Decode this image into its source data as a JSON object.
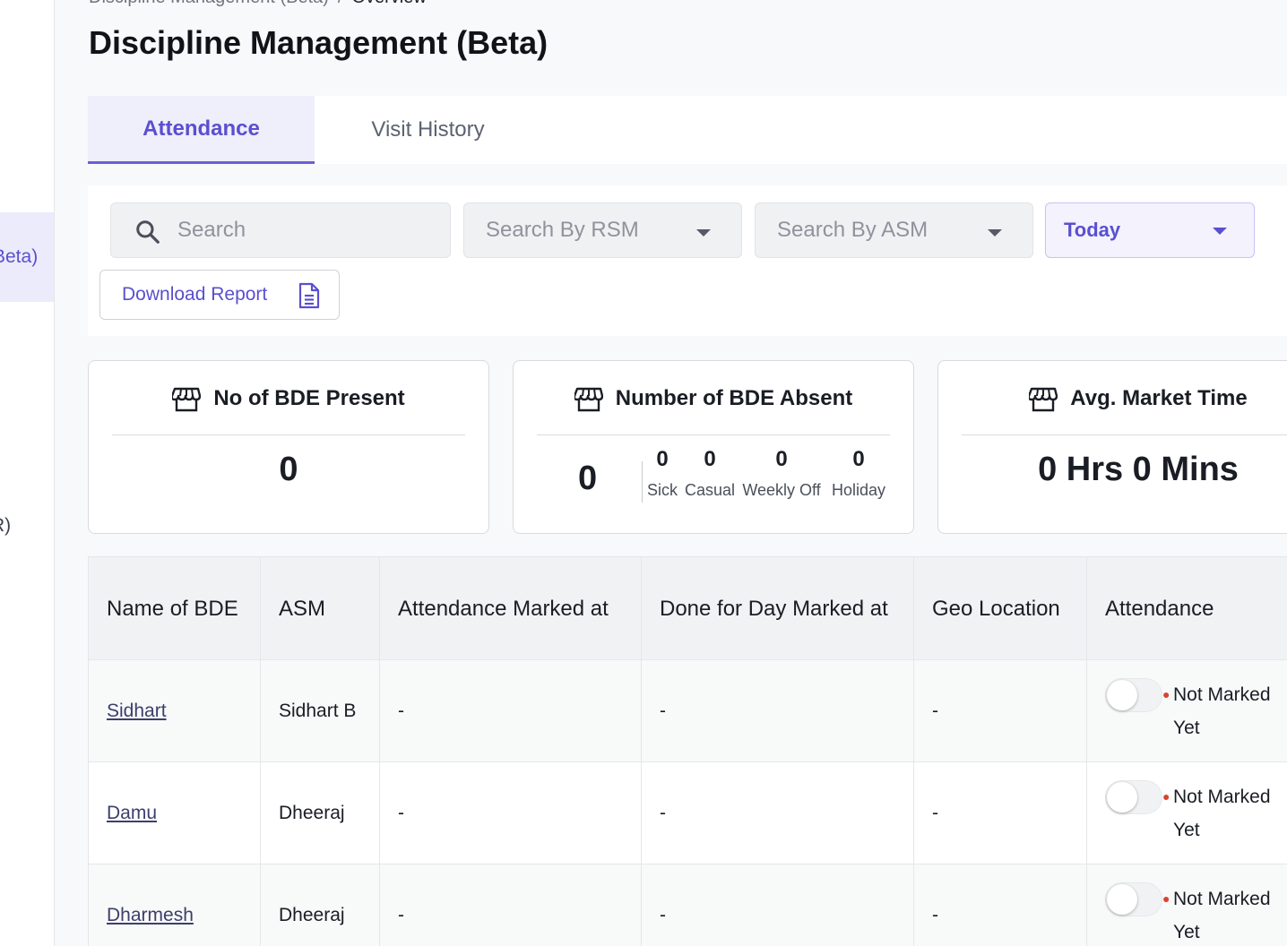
{
  "sidebar": {
    "active_item_label": "Beta)",
    "item2_label": "R)"
  },
  "breadcrumb": {
    "parent": "Discipline Management (Beta)",
    "separator": "/",
    "current": "Overview"
  },
  "page": {
    "title": "Discipline Management (Beta)"
  },
  "tabs": [
    {
      "label": "Attendance",
      "active": true
    },
    {
      "label": "Visit History",
      "active": false
    }
  ],
  "filters": {
    "search_placeholder": "Search",
    "rsm_placeholder": "Search By RSM",
    "asm_placeholder": "Search By ASM",
    "date_range": "Today",
    "download_label": "Download Report"
  },
  "cards": {
    "present": {
      "title": "No of BDE Present",
      "value": "0",
      "icon": "store-icon"
    },
    "absent": {
      "title": "Number of BDE Absent",
      "total": "0",
      "icon": "store-icon",
      "breakdown": [
        {
          "label": "Sick",
          "value": "0"
        },
        {
          "label": "Casual",
          "value": "0"
        },
        {
          "label": "Weekly Off",
          "value": "0"
        },
        {
          "label": "Holiday",
          "value": "0"
        }
      ]
    },
    "market_time": {
      "title": "Avg. Market Time",
      "value": "0 Hrs 0 Mins",
      "icon": "store-icon"
    }
  },
  "table": {
    "columns": [
      "Name of BDE",
      "ASM",
      "Attendance Marked at",
      "Done for Day Marked at",
      "Geo Location",
      "Attendance"
    ],
    "rows": [
      {
        "name": "Sidhart",
        "asm": "Sidhart B",
        "attendance_marked": "-",
        "done_for_day": "-",
        "geo": "-",
        "status": "Not Marked Yet"
      },
      {
        "name": "Damu",
        "asm": "Dheeraj",
        "attendance_marked": "-",
        "done_for_day": "-",
        "geo": "-",
        "status": "Not Marked Yet"
      },
      {
        "name": "Dharmesh",
        "asm": "Dheeraj",
        "attendance_marked": "-",
        "done_for_day": "-",
        "geo": "-",
        "status": "Not Marked Yet"
      }
    ]
  },
  "colors": {
    "accent": "#5a4fcf",
    "status_dot": "#d9442f"
  }
}
